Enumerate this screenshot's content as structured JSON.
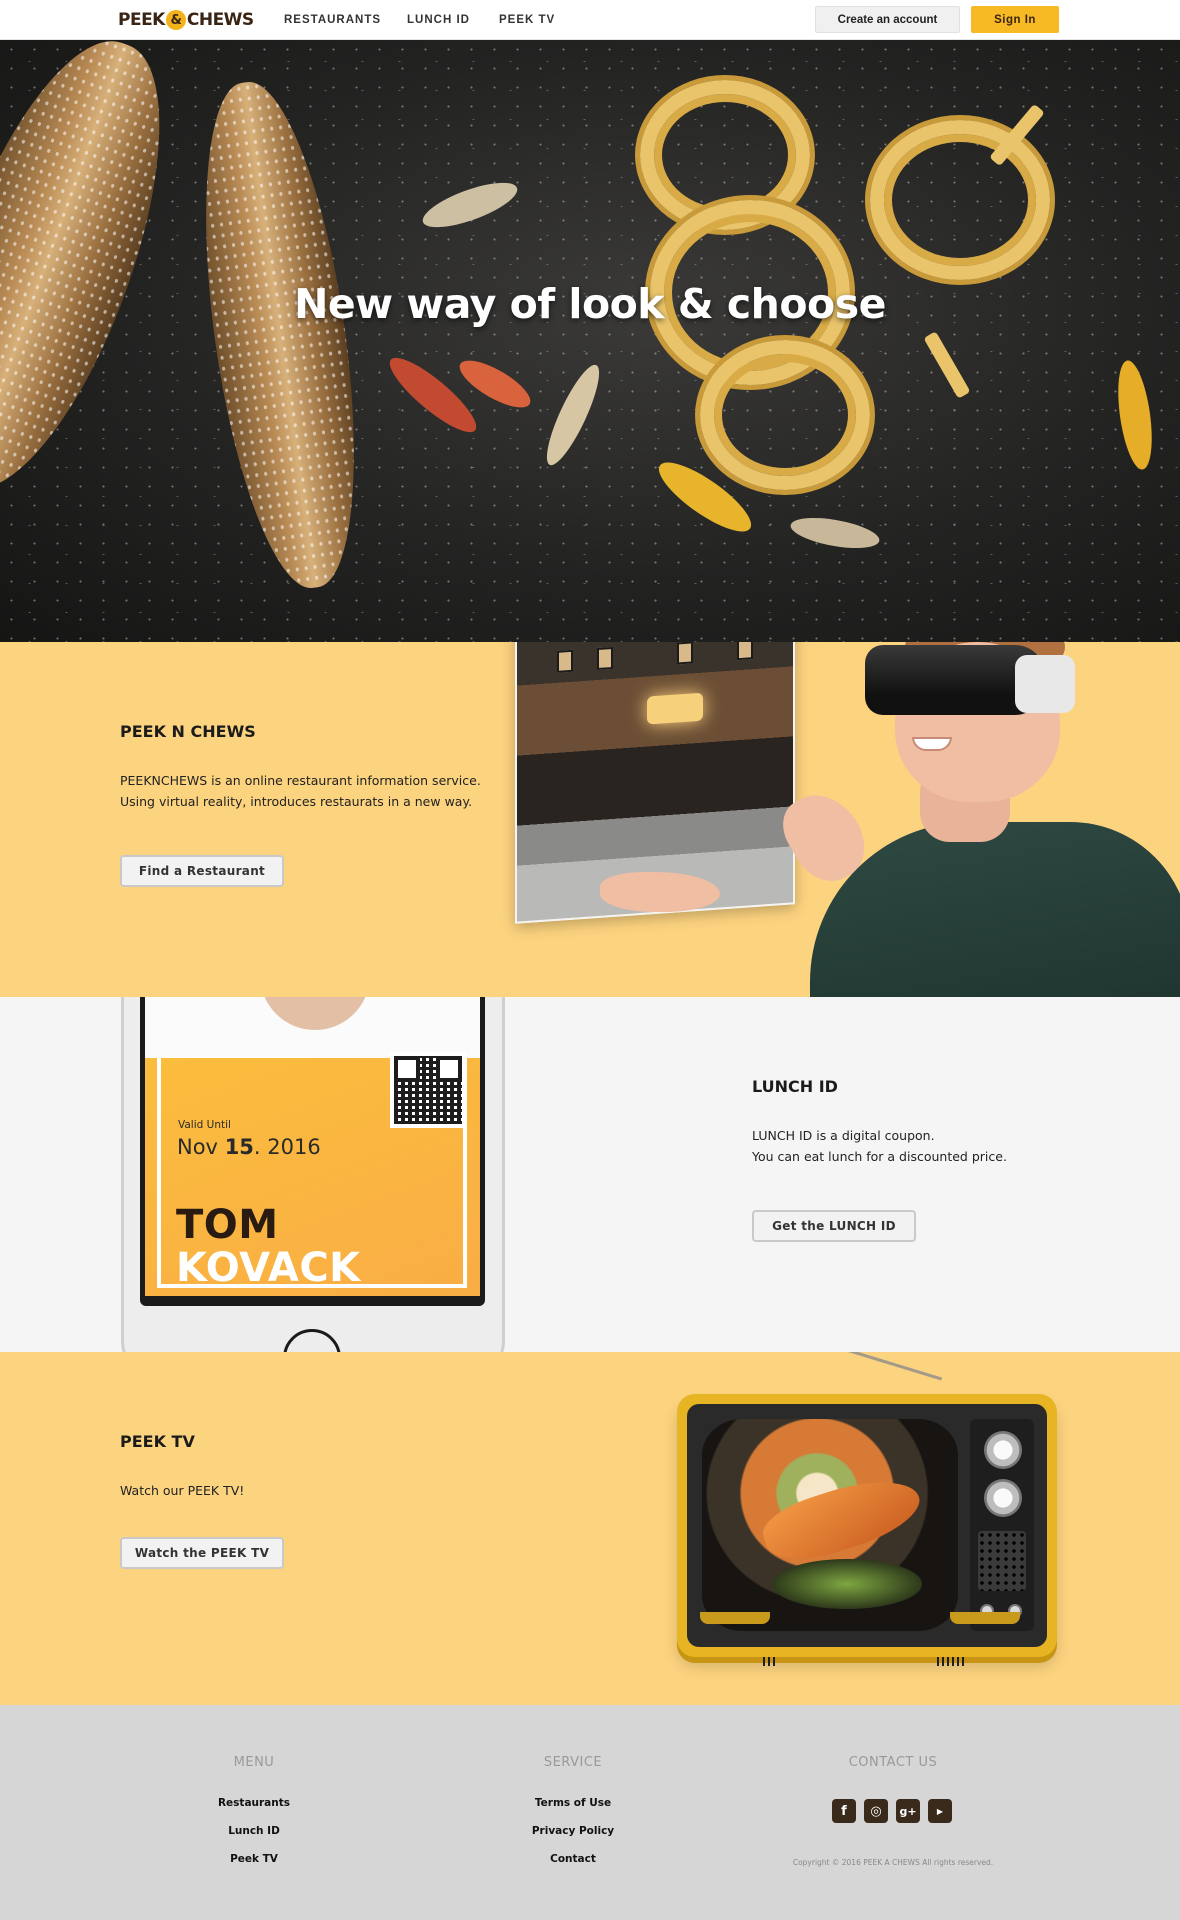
{
  "nav": {
    "logo_left": "PEEK",
    "logo_amp": "&",
    "logo_right": "CHEWS",
    "links": [
      "RESTAURANTS",
      "LUNCH ID",
      "PEEK TV"
    ],
    "create_label": "Create an account",
    "signin_label": "Sign In"
  },
  "hero": {
    "title": "New way of look & choose"
  },
  "peek": {
    "title": "PEEK N CHEWS",
    "text_line1": "PEEKNCHEWS is an online restaurant information service.",
    "text_line2": "Using virtual reality, introduces restaurats in a new way.",
    "button": "Find a Restaurant"
  },
  "lunch": {
    "title": "LUNCH ID",
    "text_line1": "LUNCH ID is a digital coupon.",
    "text_line2": "You can eat lunch for a discounted price.",
    "button": "Get the LUNCH ID",
    "card": {
      "valid_label": "Valid Until",
      "date_month": "Nov",
      "date_day": "15",
      "date_year": ". 2016",
      "first_name": "TOM",
      "last_name": "KOVACK"
    }
  },
  "tv": {
    "title": "PEEK TV",
    "text": "Watch our PEEK TV!",
    "button": "Watch the PEEK TV"
  },
  "footer": {
    "menu_heading": "MENU",
    "menu_links": [
      "Restaurants",
      "Lunch ID",
      "Peek TV"
    ],
    "service_heading": "SERVICE",
    "service_links": [
      "Terms of Use",
      "Privacy Policy",
      "Contact"
    ],
    "contact_heading": "CONTACT US",
    "social": [
      "facebook-icon",
      "instagram-icon",
      "google-plus-icon",
      "youtube-icon"
    ],
    "copyright": "Copyright © 2016 PEEK A CHEWS All rights reserved."
  },
  "colors": {
    "accent": "#f7b924",
    "section_yellow": "#fcd37f",
    "footer_gray": "#d6d6d6"
  }
}
